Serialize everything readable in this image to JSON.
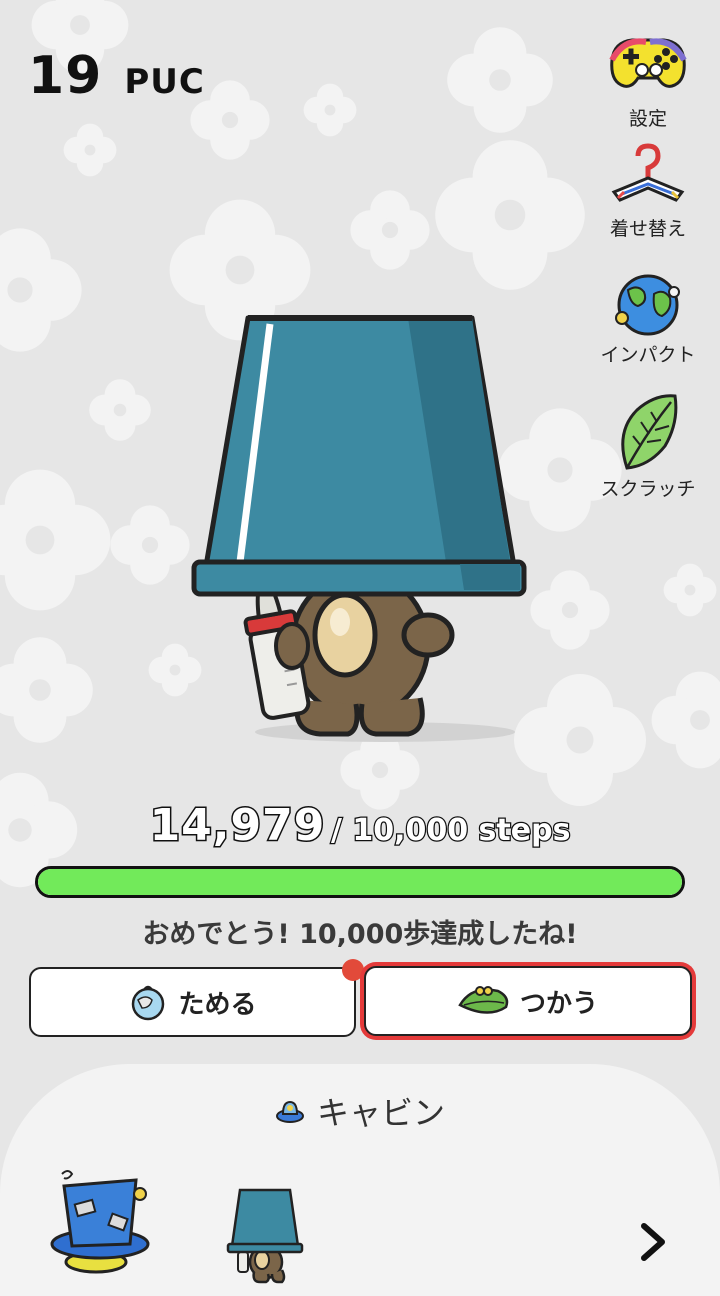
{
  "wallet": {
    "amount": "19",
    "unit": "PUC"
  },
  "menu": [
    {
      "label": "設定",
      "icon": "gamepad-icon"
    },
    {
      "label": "着せ替え",
      "icon": "hanger-icon"
    },
    {
      "label": "インパクト",
      "icon": "globe-icon"
    },
    {
      "label": "スクラッチ",
      "icon": "leaf-icon"
    }
  ],
  "steps": {
    "current": "14,979",
    "goal_text": "/ 10,000 steps",
    "progress": 1.0
  },
  "message": "おめでとう! 10,000歩達成したね!",
  "buttons": {
    "save": "ためる",
    "use": "つかう"
  },
  "cabin": {
    "title": "キャビン"
  },
  "colors": {
    "progress": "#72ea5a",
    "bucket": "#3b8aa0",
    "highlight": "#e43a3a",
    "background": "#e6e6e6"
  }
}
